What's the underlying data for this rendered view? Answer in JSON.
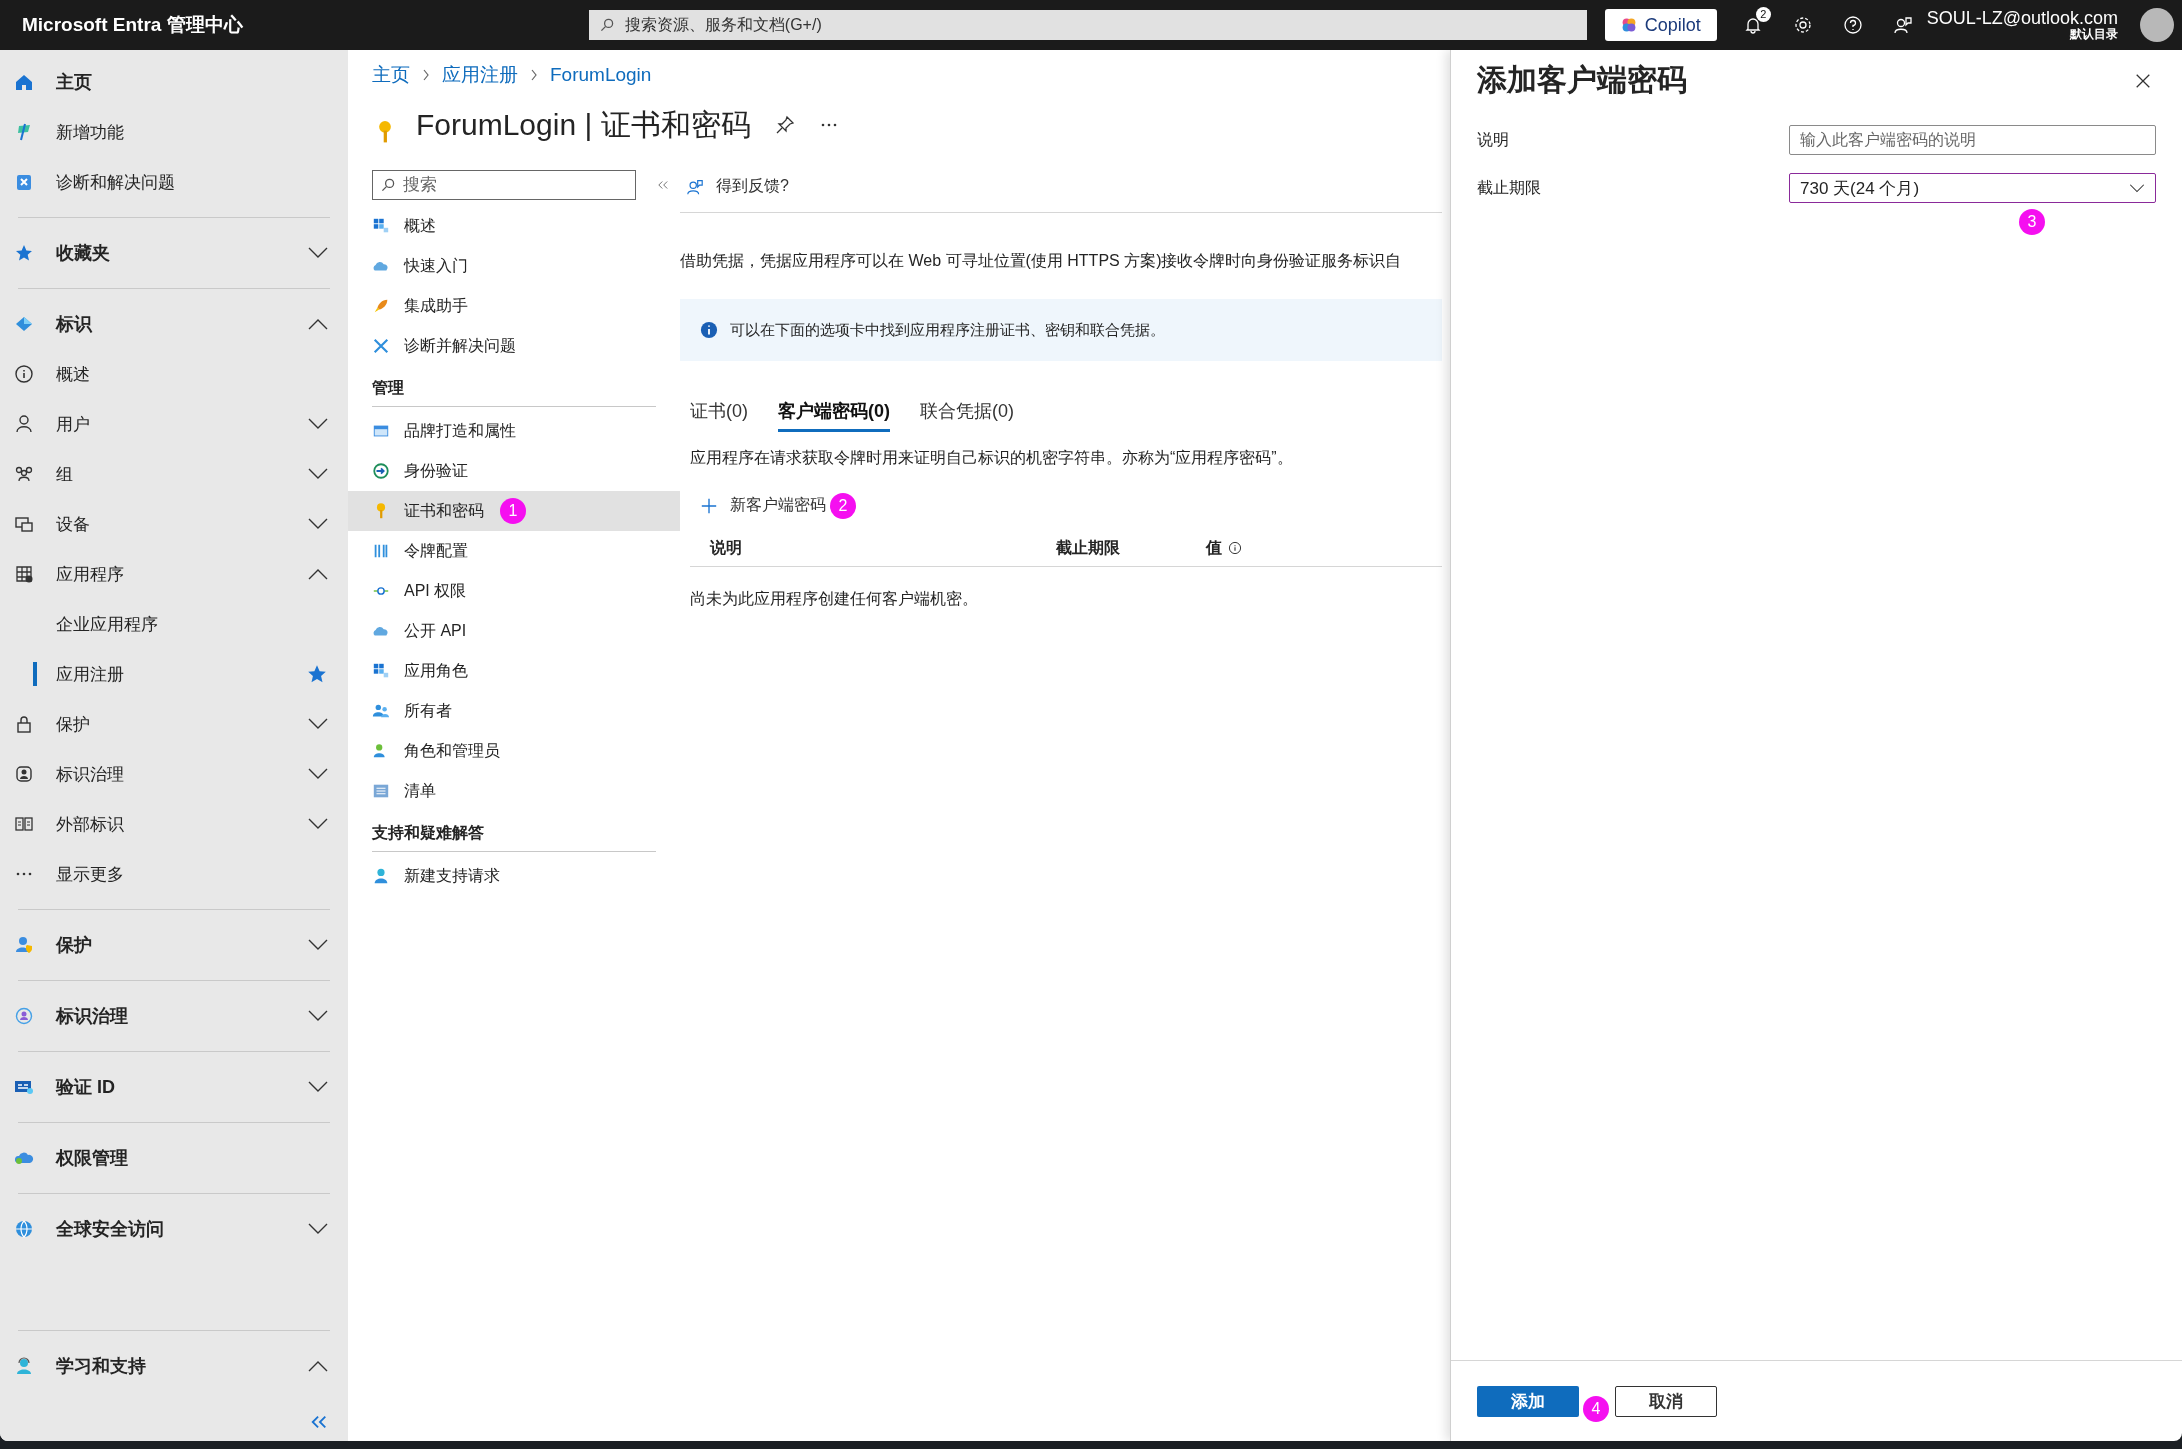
{
  "top_bar": {
    "brand": "Microsoft Entra 管理中心",
    "search": {
      "placeholder": "搜索资源、服务和文档(G+/)"
    },
    "copilot": "Copilot",
    "notifications_count": "2",
    "account": {
      "email": "SOUL-LZ@outlook.com",
      "directory": "默认目录"
    }
  },
  "sidebar": {
    "groups": [
      {
        "items": [
          {
            "label": "主页",
            "kind": "header"
          },
          {
            "label": "新增功能",
            "kind": "item"
          },
          {
            "label": "诊断和解决问题",
            "kind": "item"
          }
        ]
      },
      {
        "items": [
          {
            "label": "收藏夹",
            "kind": "header",
            "expanded": false
          }
        ]
      },
      {
        "items": [
          {
            "label": "标识",
            "kind": "header",
            "expanded": true
          },
          {
            "label": "概述",
            "kind": "item"
          },
          {
            "label": "用户",
            "kind": "item",
            "expanded": false
          },
          {
            "label": "组",
            "kind": "item",
            "expanded": false
          },
          {
            "label": "设备",
            "kind": "item",
            "expanded": false
          },
          {
            "label": "应用程序",
            "kind": "item",
            "expanded": true
          },
          {
            "label": "企业应用程序",
            "kind": "subitem",
            "selected": false,
            "starred": false
          },
          {
            "label": "应用注册",
            "kind": "subitem",
            "selected": true,
            "starred": true
          },
          {
            "label": "保护",
            "kind": "item",
            "expanded": false
          },
          {
            "label": "标识治理",
            "kind": "item",
            "expanded": false
          },
          {
            "label": "外部标识",
            "kind": "item",
            "expanded": false
          },
          {
            "label": "显示更多",
            "kind": "item"
          }
        ]
      },
      {
        "items": [
          {
            "label": "保护",
            "kind": "header",
            "expanded": false
          }
        ]
      },
      {
        "items": [
          {
            "label": "标识治理",
            "kind": "header",
            "expanded": false
          }
        ]
      },
      {
        "items": [
          {
            "label": "验证 ID",
            "kind": "header",
            "expanded": false
          }
        ]
      },
      {
        "items": [
          {
            "label": "权限管理",
            "kind": "header"
          }
        ]
      },
      {
        "items": [
          {
            "label": "全球安全访问",
            "kind": "header",
            "expanded": false
          }
        ]
      },
      {
        "items": [
          {
            "label": "学习和支持",
            "kind": "header",
            "expanded": true
          }
        ]
      }
    ]
  },
  "breadcrumb": [
    "主页",
    "应用注册",
    "ForumLogin"
  ],
  "page_title": "ForumLogin | 证书和密码",
  "resource_menu": {
    "search": {
      "placeholder": "搜索"
    },
    "items": [
      {
        "label": "概述",
        "kind": "item",
        "selected": false
      },
      {
        "label": "快速入门",
        "kind": "item",
        "selected": false
      },
      {
        "label": "集成助手",
        "kind": "item",
        "selected": false
      },
      {
        "label": "诊断并解决问题",
        "kind": "item",
        "selected": false
      },
      {
        "label": "管理",
        "kind": "header"
      },
      {
        "label": "品牌打造和属性",
        "kind": "item",
        "selected": false
      },
      {
        "label": "身份验证",
        "kind": "item",
        "selected": false
      },
      {
        "label": "证书和密码",
        "kind": "item",
        "selected": true,
        "annotation": "1"
      },
      {
        "label": "令牌配置",
        "kind": "item",
        "selected": false
      },
      {
        "label": "API 权限",
        "kind": "item",
        "selected": false
      },
      {
        "label": "公开 API",
        "kind": "item",
        "selected": false
      },
      {
        "label": "应用角色",
        "kind": "item",
        "selected": false
      },
      {
        "label": "所有者",
        "kind": "item",
        "selected": false
      },
      {
        "label": "角色和管理员",
        "kind": "item",
        "selected": false
      },
      {
        "label": "清单",
        "kind": "item",
        "selected": false
      },
      {
        "label": "支持和疑难解答",
        "kind": "header"
      },
      {
        "label": "新建支持请求",
        "kind": "item",
        "selected": false
      }
    ]
  },
  "toolbar": {
    "feedback": "得到反馈?"
  },
  "description": "借助凭据，凭据应用程序可以在 Web 可寻址位置(使用 HTTPS 方案)接收令牌时向身份验证服务标识自",
  "info_banner": "可以在下面的选项卡中找到应用程序注册证书、密钥和联合凭据。",
  "tabs": [
    {
      "label": "证书(0)",
      "selected": false
    },
    {
      "label": "客户端密码(0)",
      "selected": true
    },
    {
      "label": "联合凭据(0)",
      "selected": false
    }
  ],
  "tab_description": "应用程序在请求获取令牌时用来证明自己标识的机密字符串。亦称为“应用程序密码”。",
  "new_secret_button": {
    "label": "新客户端密码",
    "annotation": "2"
  },
  "table": {
    "columns": [
      "说明",
      "截止期限",
      "值"
    ],
    "empty_text": "尚未为此应用程序创建任何客户端机密。"
  },
  "panel": {
    "title": "添加客户端密码",
    "fields": [
      {
        "label": "说明",
        "kind": "text",
        "placeholder": "输入此客户端密码的说明"
      },
      {
        "label": "截止期限",
        "kind": "select",
        "value": "730 天(24 个月)",
        "annotation": "3"
      }
    ],
    "buttons": [
      {
        "label": "添加",
        "kind": "primary",
        "annotation": "4"
      },
      {
        "label": "取消",
        "kind": "secondary"
      }
    ]
  }
}
